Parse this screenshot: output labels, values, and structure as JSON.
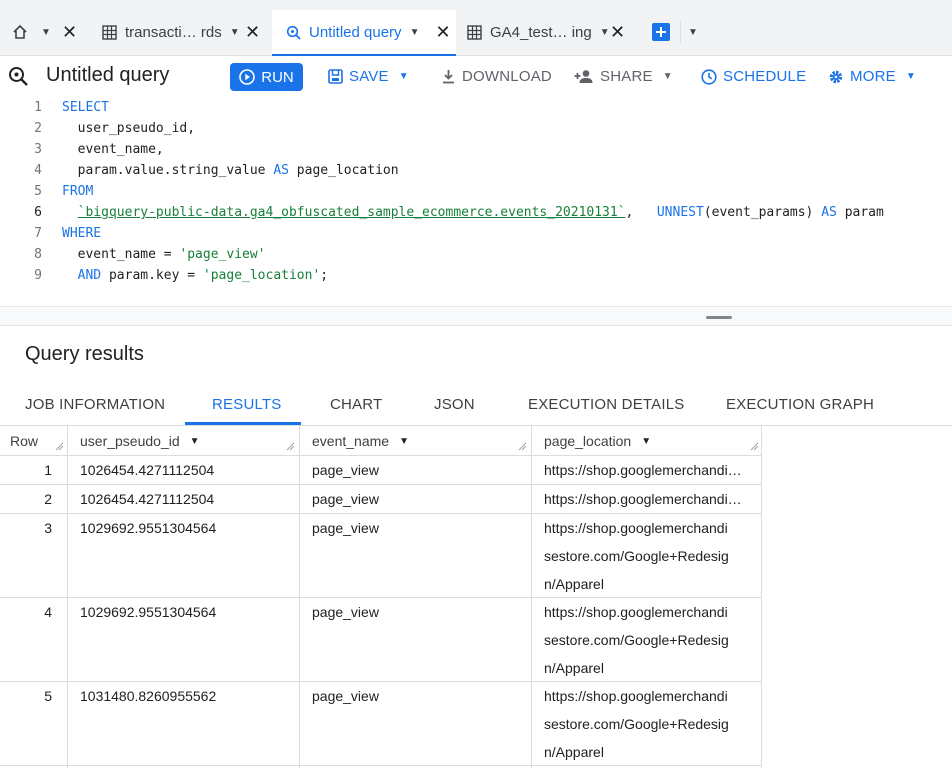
{
  "tabs": [
    {
      "label": "transacti… rds",
      "type": "table"
    },
    {
      "label": "Untitled query",
      "type": "query",
      "active": true
    },
    {
      "label": "GA4_test… ing",
      "type": "table"
    }
  ],
  "toolbar": {
    "title": "Untitled query",
    "run": "RUN",
    "save": "SAVE",
    "download": "DOWNLOAD",
    "share": "SHARE",
    "schedule": "SCHEDULE",
    "more": "MORE"
  },
  "editor": {
    "line_numbers": [
      "1",
      "2",
      "3",
      "4",
      "5",
      "6",
      "7",
      "8",
      "9"
    ],
    "l1": "SELECT",
    "l2": "  user_pseudo_id,",
    "l3": "  event_name,",
    "l4a": "  param.value.string_value ",
    "l4b": "AS",
    "l4c": " page_location",
    "l5": "FROM",
    "l6a": "  ",
    "l6b": "`bigquery-public-data.ga4_obfuscated_sample_ecommerce.events_20210131`",
    "l6c": ",   ",
    "l6d": "UNNEST",
    "l6e": "(event_params) ",
    "l6f": "AS",
    "l6g": " param",
    "l7": "WHERE",
    "l8a": "  event_name = ",
    "l8b": "'page_view'",
    "l9a": "  ",
    "l9b": "AND",
    "l9c": " param.key = ",
    "l9d": "'page_location'",
    "l9e": ";"
  },
  "results": {
    "title": "Query results",
    "tabs": [
      "JOB INFORMATION",
      "RESULTS",
      "CHART",
      "JSON",
      "EXECUTION DETAILS",
      "EXECUTION GRAPH"
    ],
    "columns": [
      "Row",
      "user_pseudo_id",
      "event_name",
      "page_location"
    ],
    "rows": [
      {
        "row": "1",
        "user_pseudo_id": "1026454.4271112504",
        "event_name": "page_view",
        "page_location": [
          "https://shop.googlemerchandi…"
        ]
      },
      {
        "row": "2",
        "user_pseudo_id": "1026454.4271112504",
        "event_name": "page_view",
        "page_location": [
          "https://shop.googlemerchandi…"
        ]
      },
      {
        "row": "3",
        "user_pseudo_id": "1029692.9551304564",
        "event_name": "page_view",
        "page_location": [
          "https://shop.googlemerchandi",
          "sestore.com/Google+Redesig",
          "n/Apparel"
        ]
      },
      {
        "row": "4",
        "user_pseudo_id": "1029692.9551304564",
        "event_name": "page_view",
        "page_location": [
          "https://shop.googlemerchandi",
          "sestore.com/Google+Redesig",
          "n/Apparel"
        ]
      },
      {
        "row": "5",
        "user_pseudo_id": "1031480.8260955562",
        "event_name": "page_view",
        "page_location": [
          "https://shop.googlemerchandi",
          "sestore.com/Google+Redesig",
          "n/Apparel"
        ]
      }
    ]
  },
  "colors": {
    "accent": "#1a73e8",
    "string": "#188038"
  }
}
